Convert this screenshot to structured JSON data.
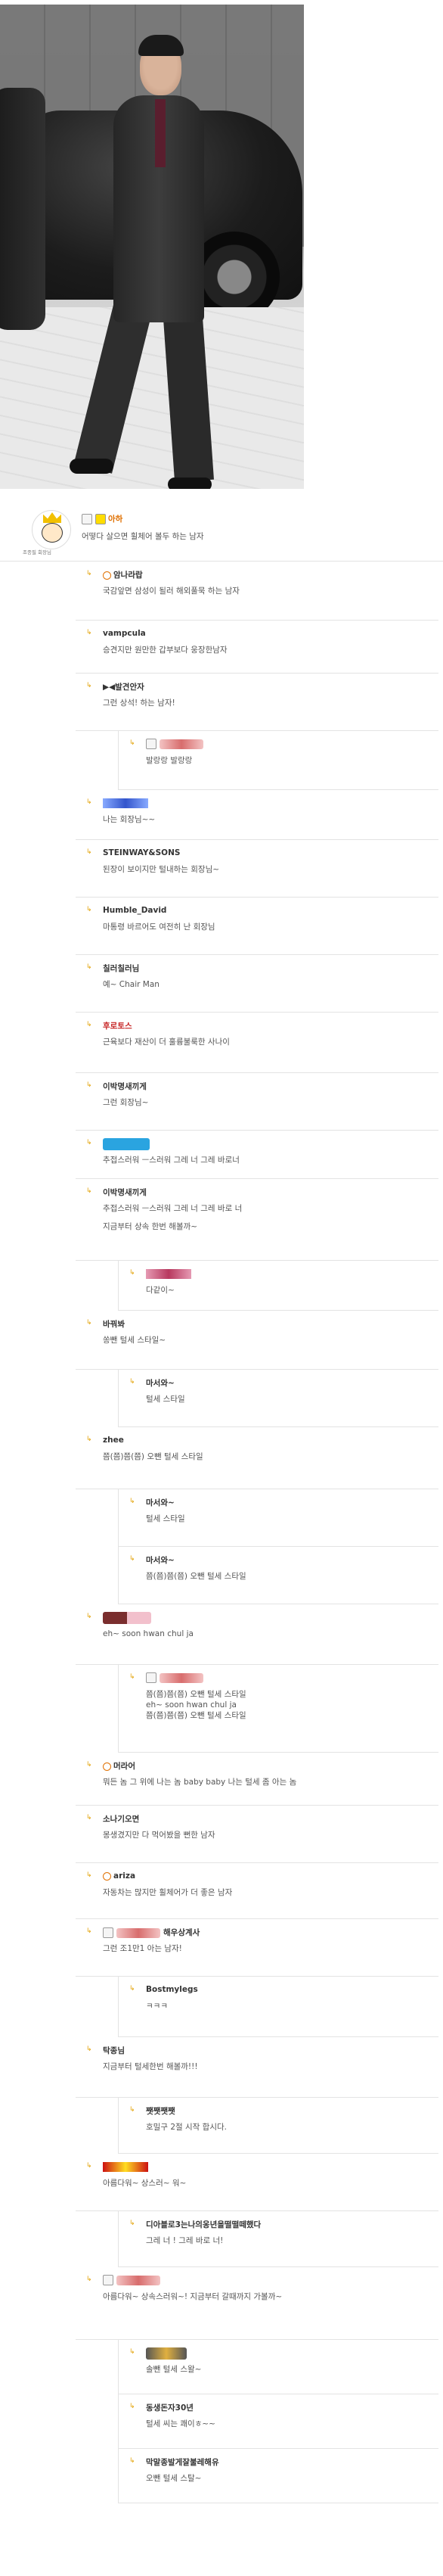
{
  "comments": [
    {
      "id": "main",
      "level": 0,
      "name": "아하",
      "text": "어떻다 살으면 휠체어 볼두 하는 남자",
      "extra_text": ""
    },
    {
      "id": "c1",
      "level": 1,
      "name": "암나라랍",
      "text": "국감앞면 삼성이 될러 해외풀묵 하는 남자"
    },
    {
      "id": "c2",
      "level": 1,
      "name": "vampcula",
      "text": "승견지만 원만한 갑부보다 웅장한남자"
    },
    {
      "id": "c3",
      "level": 1,
      "name": "▶◀발견안자",
      "text": "그런 상석! 하는 남자!"
    },
    {
      "id": "c3r",
      "level": 2,
      "name": "",
      "text": "발랑랑 발랑랑"
    },
    {
      "id": "c4",
      "level": 1,
      "name": "",
      "text": "나는 회장님~~"
    },
    {
      "id": "c5",
      "level": 1,
      "name": "STEINWAY&SONS",
      "text": "된장이 보이지만 털내하는 회장님~"
    },
    {
      "id": "c6",
      "level": 1,
      "name": "Humble_David",
      "text": "마통령 바르어도 여전히 난 회장님"
    },
    {
      "id": "c7",
      "level": 1,
      "name": "칠러칠러님",
      "text": "예~ Chair Man"
    },
    {
      "id": "c8",
      "level": 1,
      "name": "후로토스",
      "text": "근육보다 재산이 더 훌륭불룩한 사나이"
    },
    {
      "id": "c9",
      "level": 1,
      "name": "이박명새끼게",
      "text": "그런 회장님~"
    },
    {
      "id": "c10",
      "level": 1,
      "name": "",
      "text": "추접스러워 ㅡ스러워 그레 너 그레 바로너"
    },
    {
      "id": "c11",
      "level": 1,
      "name": "이박명새끼게",
      "text": "추접스러워 ㅡ스러워 그레 너 그레 바로 너",
      "text2": "지금부터 상속 한번 해볼까~"
    },
    {
      "id": "c11r",
      "level": 2,
      "name": "",
      "text": "다같이~"
    },
    {
      "id": "c12",
      "level": 1,
      "name": "바꿔봐",
      "text": "쏭뺀 털세 스타일~"
    },
    {
      "id": "c12r",
      "level": 2,
      "name": "마서와~",
      "text": "털세 스타일"
    },
    {
      "id": "c13",
      "level": 1,
      "name": "zhee",
      "text": "쯤(쯤)쯤(쯤) 오뺀 털세 스타일"
    },
    {
      "id": "c13r1",
      "level": 2,
      "name": "마서와~",
      "text": "털세 스타일"
    },
    {
      "id": "c13r2",
      "level": 2,
      "name": "마서와~",
      "text": "쯤(쯤)쯤(쯤) 오뺀 털세 스타일"
    },
    {
      "id": "c14",
      "level": 1,
      "name": "",
      "text": "eh~ soon hwan chul ja"
    },
    {
      "id": "c14r",
      "level": 2,
      "name": "",
      "text": "쯤(쯤)쯤(쯤) 오뺀 털세 스타일",
      "text2": "eh~ soon hwan chul ja",
      "text3": "쯤(쯤)쯤(쯤) 오뺀 털세 스타일"
    },
    {
      "id": "c15",
      "level": 1,
      "name": "머라어",
      "text": "뭐든 놈 그 위에 나는 놈 baby baby 나는 털세 좀 아는 놈"
    },
    {
      "id": "c16",
      "level": 1,
      "name": "소나기오면",
      "text": "몽생겼지만 다 먹어봤을 뻔한 남자"
    },
    {
      "id": "c17",
      "level": 1,
      "name": "ariza",
      "text": "자동차는 많지만 휠체어가 더 좋은 남자"
    },
    {
      "id": "c18",
      "level": 1,
      "name": "해우상계사",
      "text": "그런 조1만1 아는 남자!"
    },
    {
      "id": "c18r",
      "level": 2,
      "name": "Bostmylegs",
      "text": "ㅋㅋㅋ"
    },
    {
      "id": "c19",
      "level": 1,
      "name": "탁종님",
      "text": "지금부터 털세한번 해볼까!!!"
    },
    {
      "id": "c19r",
      "level": 2,
      "name": "쨋쨋쨋쨋",
      "text": "호밀구 2절 시작 합시다."
    },
    {
      "id": "c20",
      "level": 1,
      "name": "",
      "text": "아름다워~ 상스러~ 워~"
    },
    {
      "id": "c20r",
      "level": 2,
      "name": "디아블로3는나의옹년을떨떨떼했다",
      "text": "그레 너 ! 그레 바로 너!"
    },
    {
      "id": "c21",
      "level": 1,
      "name": "",
      "text": "아름다워~ 상속스러워~! 지금부터 갈때까지 가볼까~"
    },
    {
      "id": "c21r1",
      "level": 2,
      "name": "",
      "text": "솔뺀 털세 스왈~"
    },
    {
      "id": "c21r2",
      "level": 2,
      "name": "동생돈자30년",
      "text": "털세 씨는 쾌이ㅎ~~"
    },
    {
      "id": "c21r3",
      "level": 2,
      "name": "막말종발게잘불레해유",
      "text": "오뺀 털세 스탈~"
    }
  ],
  "main_avatar_caption": "조종필 회장님",
  "colors": {
    "border": "#e3e3e3",
    "accent": "#e2a000",
    "red_name": "#c62222",
    "text": "#555555",
    "name": "#333333"
  },
  "icons": {
    "reply": "reply-arrow-icon",
    "avatar": "avatar-icon"
  }
}
